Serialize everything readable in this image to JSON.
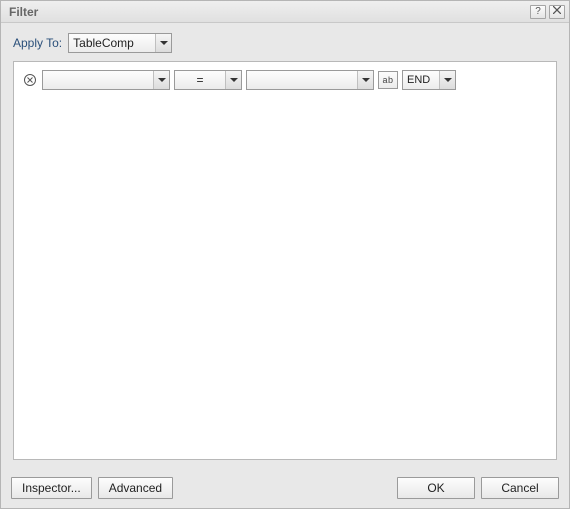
{
  "dialog": {
    "title": "Filter"
  },
  "applyTo": {
    "label": "Apply To:",
    "value": "TableComp"
  },
  "rule": {
    "field": "",
    "operator": "=",
    "value": "",
    "format_button": "ab",
    "logic": "END"
  },
  "buttons": {
    "inspector": "Inspector...",
    "advanced": "Advanced",
    "ok": "OK",
    "cancel": "Cancel"
  },
  "icons": {
    "help": "?",
    "close": "✕"
  }
}
